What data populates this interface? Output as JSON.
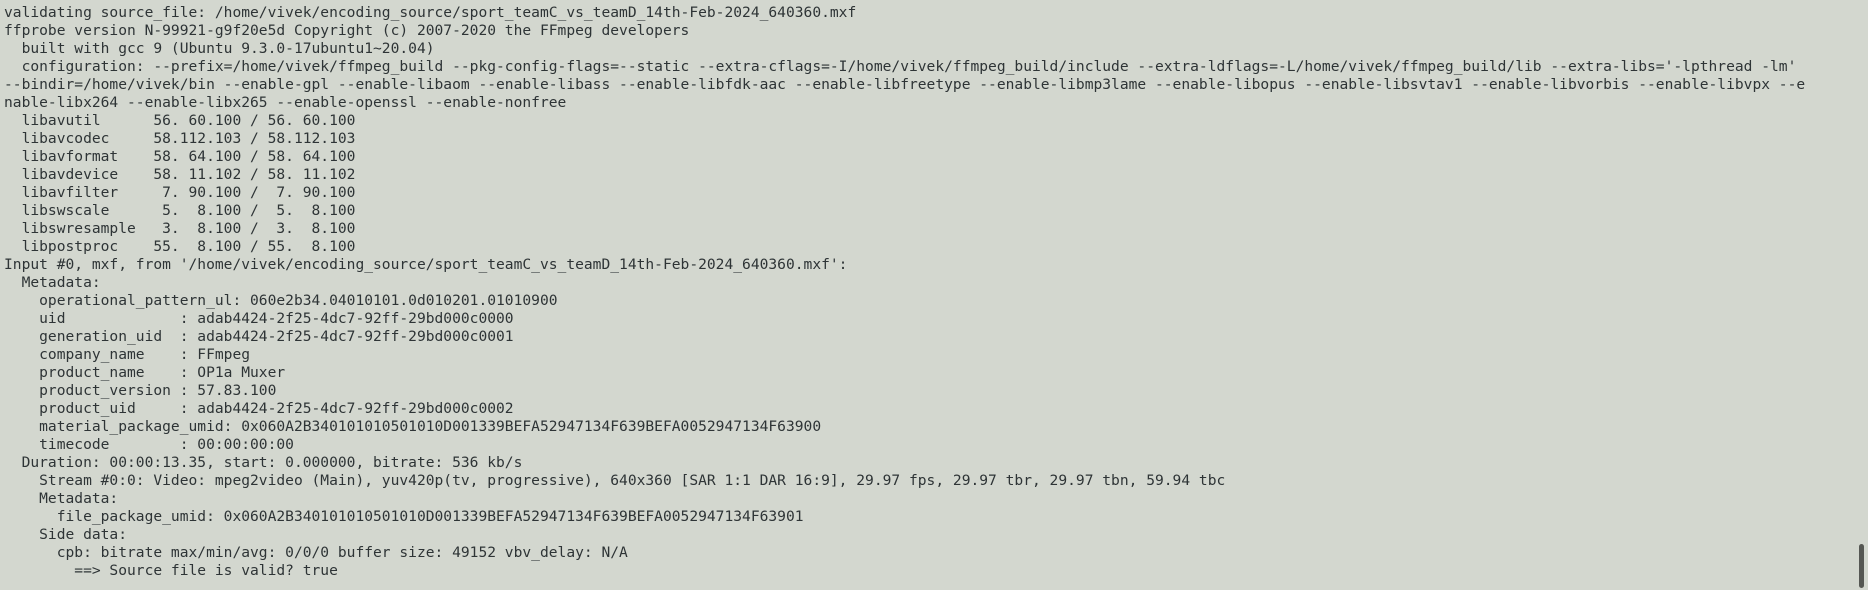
{
  "terminal": {
    "lines": [
      "validating source_file: /home/vivek/encoding_source/sport_teamC_vs_teamD_14th-Feb-2024_640360.mxf",
      "ffprobe version N-99921-g9f20e5d Copyright (c) 2007-2020 the FFmpeg developers",
      "  built with gcc 9 (Ubuntu 9.3.0-17ubuntu1~20.04)",
      "  configuration: --prefix=/home/vivek/ffmpeg_build --pkg-config-flags=--static --extra-cflags=-I/home/vivek/ffmpeg_build/include --extra-ldflags=-L/home/vivek/ffmpeg_build/lib --extra-libs='-lpthread -lm'",
      "--bindir=/home/vivek/bin --enable-gpl --enable-libaom --enable-libass --enable-libfdk-aac --enable-libfreetype --enable-libmp3lame --enable-libopus --enable-libsvtav1 --enable-libvorbis --enable-libvpx --e",
      "nable-libx264 --enable-libx265 --enable-openssl --enable-nonfree",
      "  libavutil      56. 60.100 / 56. 60.100",
      "  libavcodec     58.112.103 / 58.112.103",
      "  libavformat    58. 64.100 / 58. 64.100",
      "  libavdevice    58. 11.102 / 58. 11.102",
      "  libavfilter     7. 90.100 /  7. 90.100",
      "  libswscale      5.  8.100 /  5.  8.100",
      "  libswresample   3.  8.100 /  3.  8.100",
      "  libpostproc    55.  8.100 / 55.  8.100",
      "Input #0, mxf, from '/home/vivek/encoding_source/sport_teamC_vs_teamD_14th-Feb-2024_640360.mxf':",
      "  Metadata:",
      "    operational_pattern_ul: 060e2b34.04010101.0d010201.01010900",
      "    uid             : adab4424-2f25-4dc7-92ff-29bd000c0000",
      "    generation_uid  : adab4424-2f25-4dc7-92ff-29bd000c0001",
      "    company_name    : FFmpeg",
      "    product_name    : OP1a Muxer",
      "    product_version : 57.83.100",
      "    product_uid     : adab4424-2f25-4dc7-92ff-29bd000c0002",
      "    material_package_umid: 0x060A2B340101010501010D001339BEFA52947134F639BEFA0052947134F63900",
      "    timecode        : 00:00:00:00",
      "  Duration: 00:00:13.35, start: 0.000000, bitrate: 536 kb/s",
      "    Stream #0:0: Video: mpeg2video (Main), yuv420p(tv, progressive), 640x360 [SAR 1:1 DAR 16:9], 29.97 fps, 29.97 tbr, 29.97 tbn, 59.94 tbc",
      "    Metadata:",
      "      file_package_umid: 0x060A2B340101010501010D001339BEFA52947134F639BEFA0052947134F63901",
      "    Side data:",
      "      cpb: bitrate max/min/avg: 0/0/0 buffer size: 49152 vbv_delay: N/A",
      "        ==> Source file is valid? true"
    ]
  },
  "colors": {
    "background": "#d3d7cf",
    "text": "#2e3436",
    "scrollbar_thumb": "#555753"
  }
}
